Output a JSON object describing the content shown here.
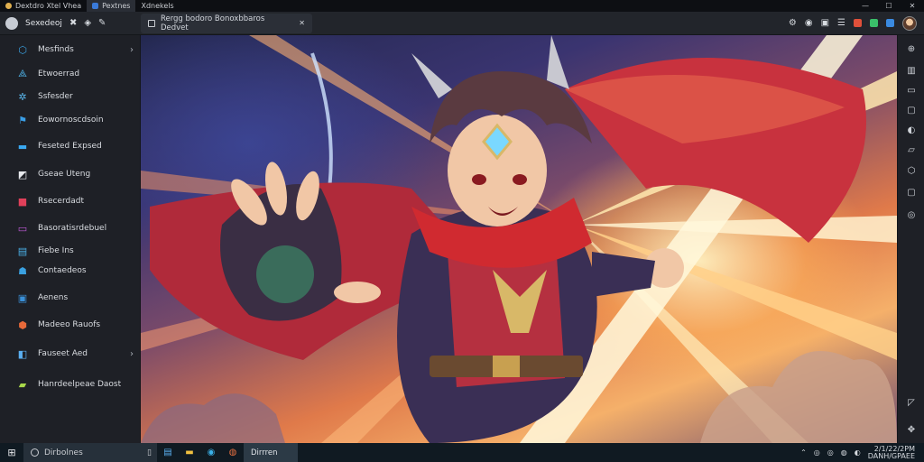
{
  "titlebar": {
    "tabs": [
      {
        "label": "Dextdro Xtel Vhea",
        "icon": "app-circle-icon"
      },
      {
        "label": "Pextnes",
        "icon": "doc-icon"
      },
      {
        "label": "Xdnekels",
        "icon": "none"
      }
    ],
    "controls": [
      "—",
      "☐",
      "✕"
    ]
  },
  "toolbar": {
    "app_title": "Sexedeoj",
    "tools": [
      "✖",
      "◈",
      "✎"
    ],
    "doc_tab": "Rergg bodoro Bonoxbbaros Dedvet",
    "doc_close": "✕",
    "right_icons": [
      "gear-icon",
      "eye-icon",
      "camera-icon",
      "list-icon",
      "app-red",
      "app-green",
      "app-blue"
    ]
  },
  "sidebar": {
    "items": [
      {
        "label": "Mesfinds",
        "icon": "⬡",
        "color": "#3aa0e0",
        "chevron": "›"
      },
      {
        "label": "Etwoerrad",
        "icon": "⟁",
        "color": "#4fb3e8",
        "chevron": ""
      },
      {
        "label": "Ssfesder",
        "icon": "✲",
        "color": "#5bb8ef",
        "chevron": ""
      },
      {
        "label": "Eowornoscdsoin",
        "icon": "⚑",
        "color": "#3a9ee6",
        "chevron": ""
      },
      {
        "label": "Feseted Expsed",
        "icon": "▬",
        "color": "#3aa8f0",
        "chevron": ""
      },
      {
        "label": "Gseae Uteng",
        "icon": "◩",
        "color": "#e8eaee",
        "chevron": ""
      },
      {
        "label": "Rsecerdadt",
        "icon": "■",
        "color": "#e0405a",
        "chevron": ""
      },
      {
        "label": "Basoratisrdebuel",
        "icon": "▭",
        "color": "#c05ad8",
        "chevron": ""
      },
      {
        "label": "Fiebe Ins",
        "icon": "▤",
        "color": "#4ab0e8",
        "chevron": ""
      },
      {
        "label": "Contaedeos",
        "icon": "☗",
        "color": "#3aa0e0",
        "chevron": ""
      },
      {
        "label": "Aenens",
        "icon": "▣",
        "color": "#3a90d8",
        "chevron": ""
      },
      {
        "label": "Madeeo Rauofs",
        "icon": "⬢",
        "color": "#e86a3a",
        "chevron": ""
      },
      {
        "label": "Fauseet Aed",
        "icon": "◧",
        "color": "#5aaef0",
        "chevron": "›"
      },
      {
        "label": "Hanrdeelpeae Daost",
        "icon": "▰",
        "color": "#a8d84a",
        "chevron": ""
      }
    ]
  },
  "rail": {
    "icons": [
      "⊕",
      "▥",
      "▭",
      "▢",
      "◐",
      "▱",
      "⬡",
      "▢",
      "◎",
      "◸",
      "✥"
    ]
  },
  "taskbar": {
    "start": "⊞",
    "search_text": "Dirbolnes",
    "icons": [
      "▯",
      "▤",
      "▬",
      "◉",
      "◍"
    ],
    "active_label": "Dirrren",
    "tray": [
      "⌃",
      "◎",
      "◎",
      "◍",
      "◐"
    ],
    "time": "2/1/22/2PM",
    "date": "DANH/GPAEE"
  }
}
